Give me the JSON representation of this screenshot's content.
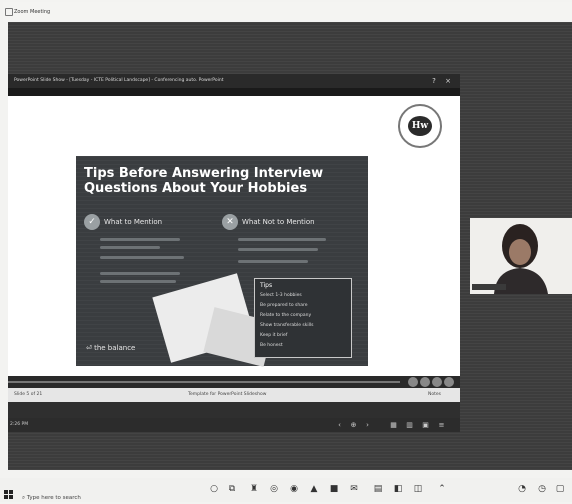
{
  "window": {
    "title": "Zoom Meeting"
  },
  "presentation": {
    "window_title": "PowerPoint Slide Show - [Tuesday - ICTE Political Landscape] - Conferencing auto. PowerPoint",
    "slide": {
      "title_line1": "Tips Before Answering Interview",
      "title_line2": "Questions About Your Hobbies",
      "col_left": "What to Mention",
      "col_right": "What Not to Mention",
      "tips_heading": "Tips",
      "tips": [
        "Select 1-3 hobbies",
        "Be prepared to share",
        "Relate to the company",
        "Show transferable skills",
        "Keep it brief",
        "Be honest"
      ],
      "brand": "the balance"
    },
    "status": {
      "slide_counter": "Slide 5 of 21",
      "center_text": "Template for PowerPoint Slideshow",
      "right": "Notes"
    }
  },
  "zoom_bar": {
    "left_text": "2:26 PM"
  },
  "taskbar": {
    "search_placeholder": "Type here to search"
  }
}
